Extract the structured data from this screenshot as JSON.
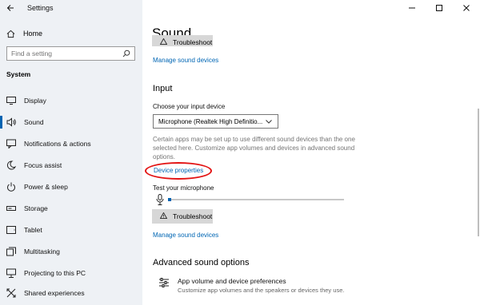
{
  "window": {
    "title": "Settings"
  },
  "sidebar": {
    "home_label": "Home",
    "search_placeholder": "Find a setting",
    "section_title": "System",
    "items": [
      {
        "label": "Display",
        "icon": "display-icon"
      },
      {
        "label": "Sound",
        "icon": "speaker-icon",
        "active": true
      },
      {
        "label": "Notifications & actions",
        "icon": "notifications-icon"
      },
      {
        "label": "Focus assist",
        "icon": "moon-icon"
      },
      {
        "label": "Power & sleep",
        "icon": "power-icon"
      },
      {
        "label": "Storage",
        "icon": "storage-icon"
      },
      {
        "label": "Tablet",
        "icon": "tablet-icon"
      },
      {
        "label": "Multitasking",
        "icon": "multitasking-icon"
      },
      {
        "label": "Projecting to this PC",
        "icon": "projecting-icon"
      },
      {
        "label": "Shared experiences",
        "icon": "shared-experiences-icon"
      }
    ]
  },
  "main": {
    "title": "Sound",
    "output": {
      "troubleshoot_label": "Troubleshoot",
      "manage_devices_link": "Manage sound devices"
    },
    "input": {
      "heading": "Input",
      "choose_label": "Choose your input device",
      "selected_device": "Microphone (Realtek High Definitio...",
      "description": "Certain apps may be set up to use different sound devices than the one selected here. Customize app volumes and devices in advanced sound options.",
      "device_properties_link": "Device properties",
      "test_label": "Test your microphone",
      "mic_level": 0.02,
      "troubleshoot_label": "Troubleshoot",
      "manage_devices_link": "Manage sound devices"
    },
    "advanced": {
      "heading": "Advanced sound options",
      "item_title": "App volume and device preferences",
      "item_desc": "Customize app volumes and the speakers or devices they use."
    }
  },
  "colors": {
    "accent": "#0063b1",
    "link": "#0066b4",
    "sidebar_bg": "#eef1f5",
    "annotation": "#e31313"
  }
}
